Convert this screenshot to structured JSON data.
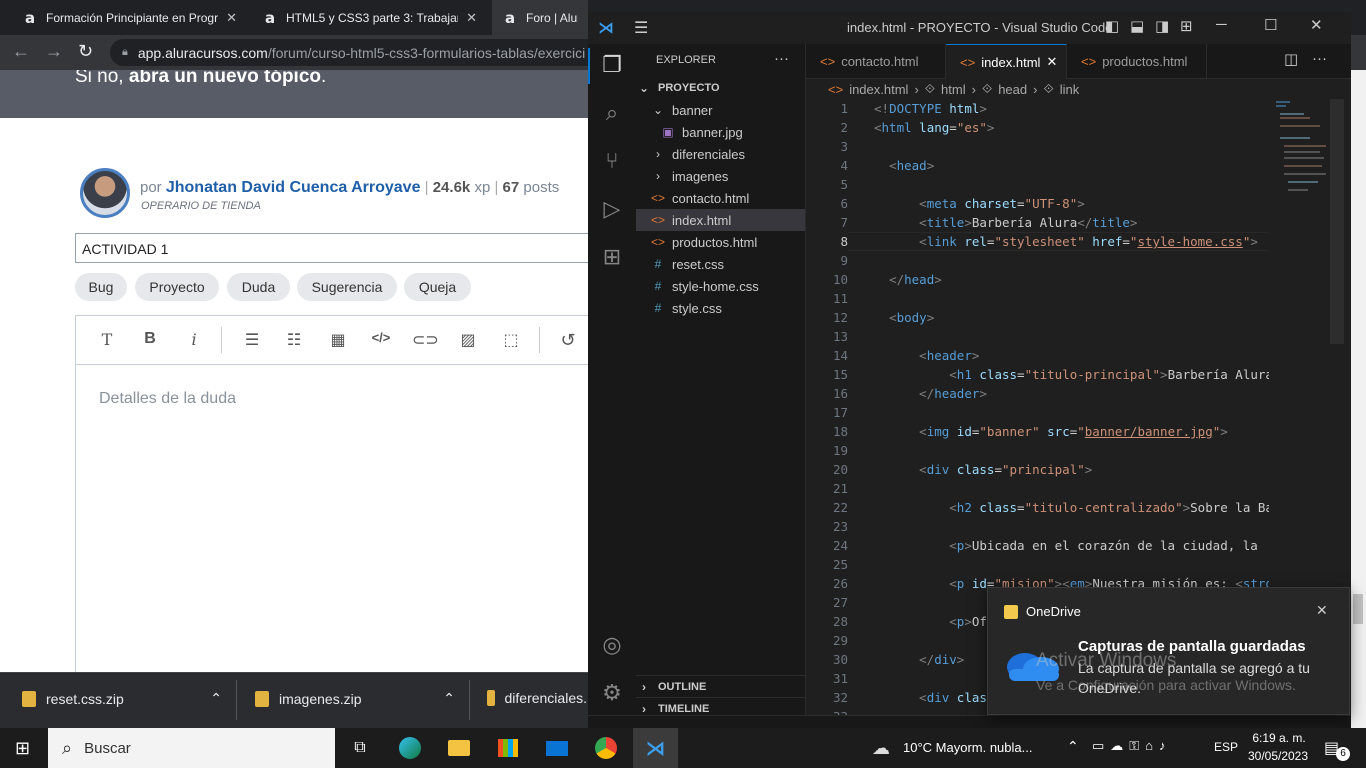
{
  "browser": {
    "tabs": [
      {
        "title": "Formación Principiante en Progra",
        "icon": "alura-icon"
      },
      {
        "title": "HTML5 y CSS3 parte 3: Trabajand",
        "icon": "alura-icon"
      },
      {
        "title": "Foro | Alura",
        "icon": "alura-icon"
      }
    ],
    "url_domain": "app.aluracursos.com",
    "url_path": "/forum/curso-html5-css3-formularios-tablas/exercici"
  },
  "page": {
    "header_prefix": "Si no, ",
    "header_bold": "abra un nuevo tópico",
    "header_suffix": ".",
    "author_prefix": "por",
    "author_name": "Jhonatan David Cuenca Arroyave",
    "xp": "24.6k",
    "xp_label": "xp",
    "posts": "67",
    "posts_label": "posts",
    "role": "OPERARIO DE TIENDA",
    "topic_title": "ACTIVIDAD 1",
    "categories": [
      "Bug",
      "Proyecto",
      "Duda",
      "Sugerencia",
      "Queja"
    ],
    "editor_placeholder": "Detalles de la duda"
  },
  "downloads": [
    {
      "name": "reset.css.zip"
    },
    {
      "name": "imagenes.zip"
    },
    {
      "name": "diferenciales."
    }
  ],
  "vscode": {
    "window_title": "index.html - PROYECTO - Visual Studio Code",
    "explorer_label": "EXPLORER",
    "project_label": "PROYECTO",
    "tree": [
      {
        "label": "banner",
        "kind": "folder-open"
      },
      {
        "label": "banner.jpg",
        "kind": "image"
      },
      {
        "label": "diferenciales",
        "kind": "folder"
      },
      {
        "label": "imagenes",
        "kind": "folder"
      },
      {
        "label": "contacto.html",
        "kind": "html"
      },
      {
        "label": "index.html",
        "kind": "html"
      },
      {
        "label": "productos.html",
        "kind": "html"
      },
      {
        "label": "reset.css",
        "kind": "css"
      },
      {
        "label": "style-home.css",
        "kind": "css"
      },
      {
        "label": "style.css",
        "kind": "css"
      }
    ],
    "outline_label": "OUTLINE",
    "timeline_label": "TIMELINE",
    "editor_tabs": [
      "contacto.html",
      "index.html",
      "productos.html"
    ],
    "active_tab": "index.html",
    "breadcrumbs": [
      "index.html",
      "html",
      "head",
      "link"
    ],
    "current_line": "8"
  },
  "notification": {
    "app": "OneDrive",
    "title": "Capturas de pantalla guardadas",
    "body": "La captura de pantalla se agregó a tu OneDrive.",
    "watermark_title": "Activar Windows",
    "watermark_sub": "Ve a Configuración para activar Windows."
  },
  "taskbar": {
    "search_placeholder": "Buscar",
    "weather": "10°C  Mayorm. nubla...",
    "lang": "ESP",
    "time": "6:19 a. m.",
    "date": "30/05/2023",
    "notif_count": "6"
  },
  "colors": {
    "vscode_accent": "#0078d4",
    "alura_blue": "#1f5fa8"
  }
}
